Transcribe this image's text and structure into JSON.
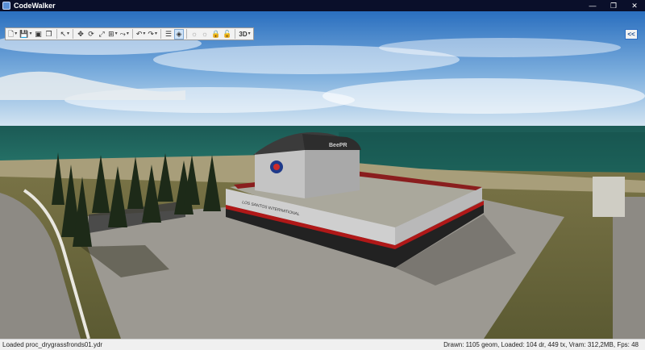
{
  "window": {
    "title": "CodeWalker",
    "minimize_glyph": "—",
    "maximize_glyph": "❐",
    "close_glyph": "✕"
  },
  "toolbar": {
    "buttons": [
      {
        "name": "new-menu",
        "icon": "new-file-icon",
        "glyph": "🗋",
        "dropdown": true
      },
      {
        "name": "save-menu",
        "icon": "save-icon",
        "glyph": "💾",
        "dropdown": true
      },
      {
        "name": "save-all",
        "icon": "save-all-icon",
        "glyph": "▣"
      },
      {
        "name": "save-copy",
        "icon": "copy-icon",
        "glyph": "❐"
      },
      {
        "name": "select-mode",
        "icon": "pointer-icon",
        "glyph": "↖",
        "dropdown": true
      },
      {
        "name": "move",
        "icon": "move-icon",
        "glyph": "✥"
      },
      {
        "name": "rotate",
        "icon": "rotate-icon",
        "glyph": "⟳"
      },
      {
        "name": "scale",
        "icon": "scale-icon",
        "glyph": "⤢"
      },
      {
        "name": "snap-menu",
        "icon": "snap-icon",
        "glyph": "⊞",
        "dropdown": true
      },
      {
        "name": "path-menu",
        "icon": "path-icon",
        "glyph": "⤳",
        "dropdown": true
      },
      {
        "name": "undo",
        "icon": "undo-icon",
        "glyph": "↶",
        "dropdown": true
      },
      {
        "name": "redo",
        "icon": "redo-icon",
        "glyph": "↷",
        "dropdown": true
      },
      {
        "name": "info",
        "icon": "info-panel-icon",
        "glyph": "☰"
      },
      {
        "name": "wireframe",
        "icon": "wireframe-icon",
        "glyph": "◈",
        "active": true
      },
      {
        "name": "lights-a",
        "icon": "light-icon",
        "glyph": "☼",
        "dim": true
      },
      {
        "name": "lights-b",
        "icon": "light-icon",
        "glyph": "☼",
        "dim": true
      },
      {
        "name": "lock",
        "icon": "lock-icon",
        "glyph": "🔒",
        "dim": true
      },
      {
        "name": "unlock",
        "icon": "unlock-icon",
        "glyph": "🔓",
        "dim": true
      },
      {
        "name": "view-mode",
        "label": "3D",
        "dropdown": true
      }
    ],
    "collapse_label": "<<"
  },
  "scene": {
    "building_sign": "BeePR",
    "wall_text": "LOS SANTOS INTERNATIONAL"
  },
  "statusbar": {
    "left": "Loaded proc_drygrassfronds01.ydr",
    "right": "Drawn: 1105 geom, Loaded: 104 dr, 449 tx, Vram: 312,2MB, Fps: 48"
  },
  "colors": {
    "sky_top": "#2a6fbf",
    "sky_horizon": "#cfe2f2",
    "sea": "#1e6b63",
    "grass": "#6d6a3a",
    "asphalt": "#8a8780",
    "building": "#c9c9c9",
    "wall_red": "#b01818"
  }
}
